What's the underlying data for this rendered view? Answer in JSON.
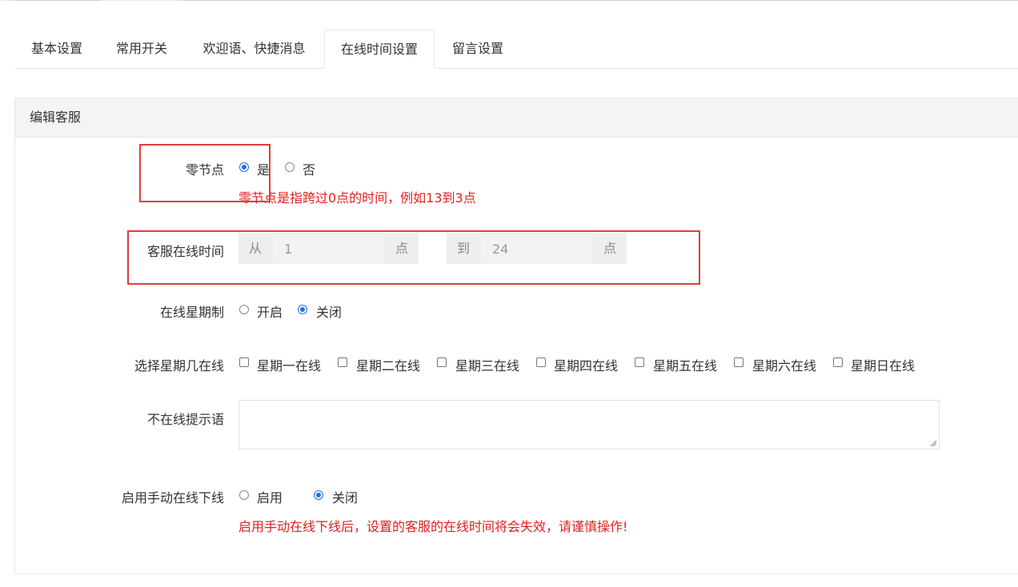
{
  "tabs": [
    {
      "label": "基本设置",
      "active": false
    },
    {
      "label": "常用开关",
      "active": false
    },
    {
      "label": "欢迎语、快捷消息",
      "active": false
    },
    {
      "label": "在线时间设置",
      "active": true
    },
    {
      "label": "留言设置",
      "active": false
    }
  ],
  "panel": {
    "title": "编辑客服"
  },
  "zero_node": {
    "label": "零节点",
    "opt_yes": "是",
    "opt_no": "否",
    "selected": "是",
    "hint": "零节点是指跨过0点的时间，例如13到3点"
  },
  "online_time": {
    "label": "客服在线时间",
    "from": "从",
    "from_value": "1",
    "unit": "点",
    "to": "到",
    "to_value": "24"
  },
  "weekday_mode": {
    "label": "在线星期制",
    "opt_on": "开启",
    "opt_off": "关闭",
    "selected": "关闭"
  },
  "weekdays": {
    "label": "选择星期几在线",
    "days": [
      "星期一在线",
      "星期二在线",
      "星期三在线",
      "星期四在线",
      "星期五在线",
      "星期六在线",
      "星期日在线"
    ]
  },
  "offline_msg": {
    "label": "不在线提示语",
    "value": ""
  },
  "manual": {
    "label": "启用手动在线下线",
    "opt_on": "启用",
    "opt_off": "关闭",
    "selected": "关闭",
    "hint": "启用手动在线下线后，设置的客服的在线时间将会失效，请谨慎操作!"
  },
  "colors": {
    "accent": "#1e6fe8",
    "warning": "#e02020",
    "highlight": "#e23c3c"
  }
}
